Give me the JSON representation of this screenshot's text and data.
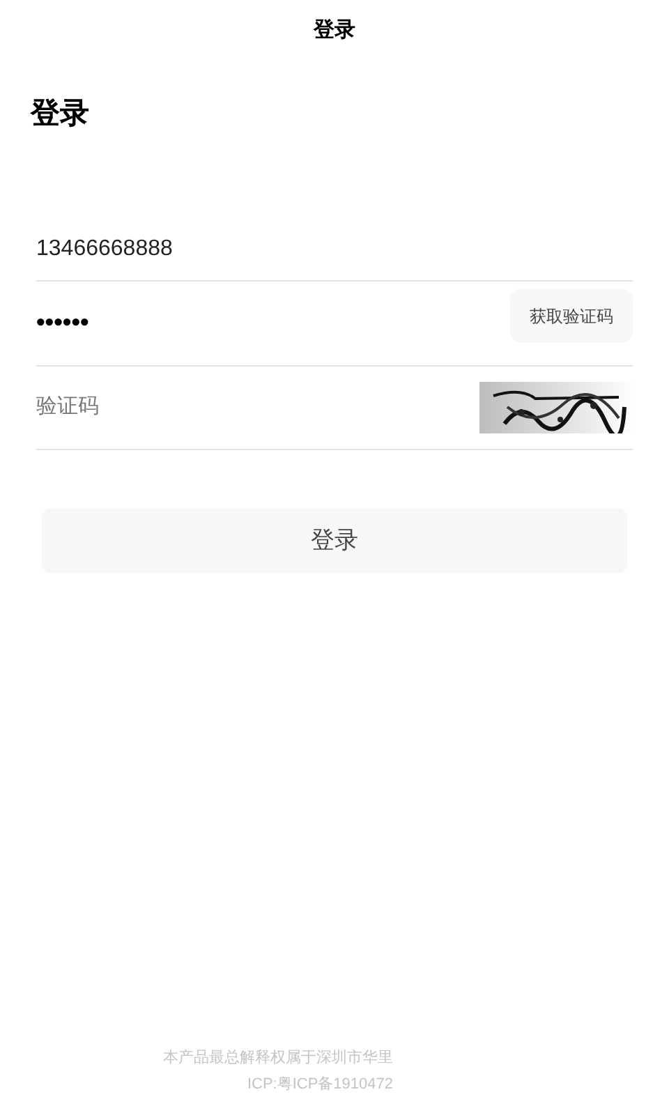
{
  "nav_bar": {
    "title": "登录"
  },
  "heading": "登录",
  "phone_field": {
    "value": "13466668888"
  },
  "password_field": {
    "value": "••••••"
  },
  "get_code_button": {
    "label": "获取验证码"
  },
  "captcha_field": {
    "placeholder": "验证码"
  },
  "login_button": {
    "label": "登录"
  },
  "footer": [
    "本产品最总解释权属于深圳市华里",
    "ICP:粤ICP备1910472"
  ]
}
